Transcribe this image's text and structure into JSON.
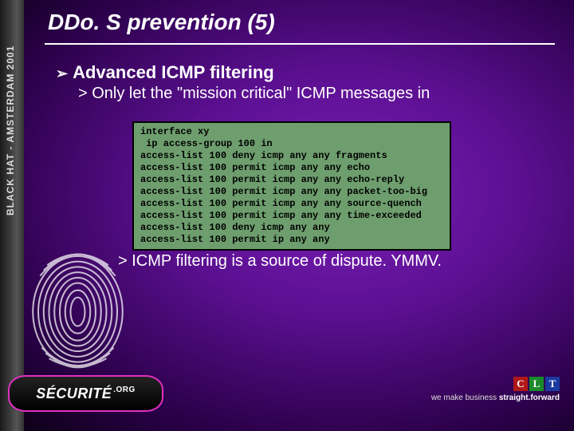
{
  "left_strip_text": "BLACK HAT - AMSTERDAM 2001",
  "title": "DDo. S prevention (5)",
  "heading": "Advanced ICMP filtering",
  "sub1": "Only let the \"mission critical\" ICMP messages in",
  "code": "interface xy\n ip access-group 100 in\naccess-list 100 deny icmp any any fragments\naccess-list 100 permit icmp any any echo\naccess-list 100 permit icmp any any echo-reply\naccess-list 100 permit icmp any any packet-too-big\naccess-list 100 permit icmp any any source-quench\naccess-list 100 permit icmp any any time-exceeded\naccess-list 100 deny icmp any any\naccess-list 100 permit ip any any",
  "note": "ICMP filtering is a source of dispute. YMMV.",
  "logo": {
    "name": "SÉCURITÉ",
    "suffix": ".ORG"
  },
  "clt": {
    "c": "C",
    "l": "L",
    "t": "T",
    "tagline_pre": "we make business ",
    "tagline_bold": "straight.forward"
  }
}
